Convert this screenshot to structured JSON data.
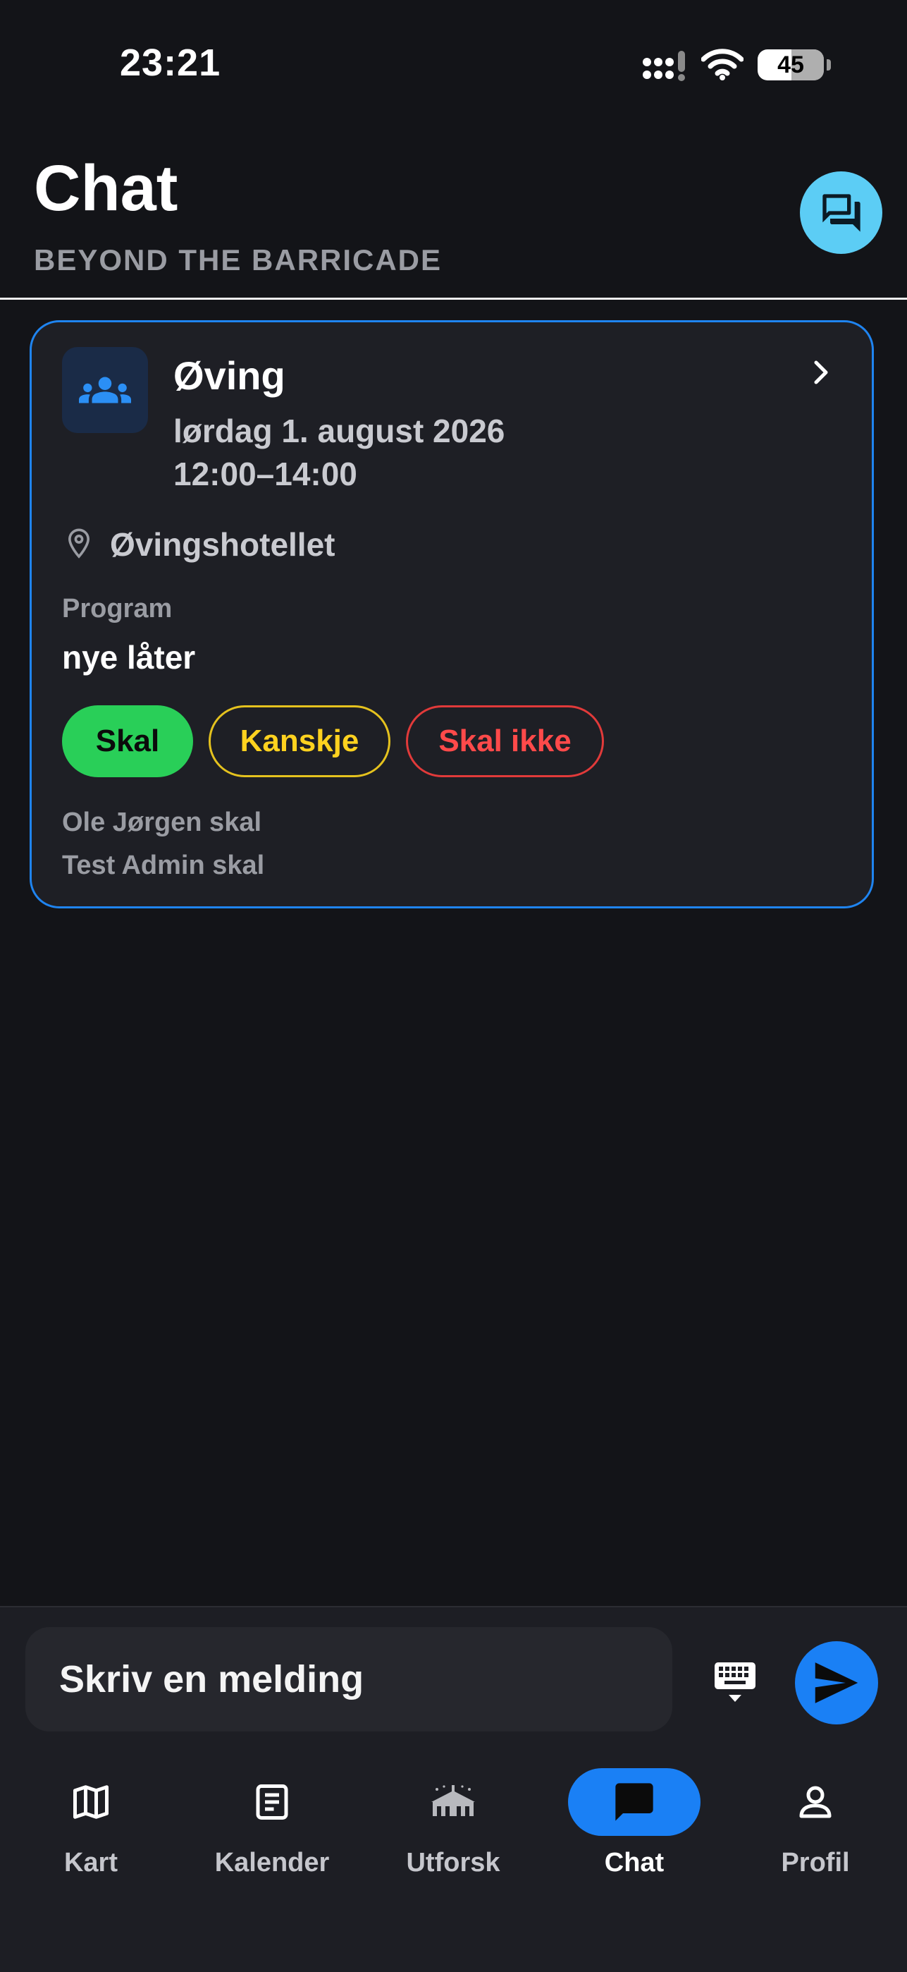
{
  "status_bar": {
    "time": "23:21",
    "battery": "45"
  },
  "header": {
    "title": "Chat",
    "subtitle": "BEYOND THE BARRICADE"
  },
  "event": {
    "title": "Øving",
    "date": "lørdag 1. august 2026",
    "time": "12:00–14:00",
    "location": "Øvingshotellet",
    "program_label": "Program",
    "program_value": "nye låter",
    "rsvp": {
      "yes": "Skal",
      "maybe": "Kanskje",
      "no": "Skal ikke"
    },
    "attendees": [
      "Ole Jørgen skal",
      "Test Admin skal"
    ]
  },
  "composer": {
    "placeholder": "Skriv en melding"
  },
  "tabs": [
    {
      "label": "Kart",
      "icon": "map-icon"
    },
    {
      "label": "Kalender",
      "icon": "document-icon"
    },
    {
      "label": "Utforsk",
      "icon": "venue-icon"
    },
    {
      "label": "Chat",
      "icon": "chat-bubble-icon",
      "active": true
    },
    {
      "label": "Profil",
      "icon": "person-icon"
    }
  ],
  "colors": {
    "background": "#131418",
    "card": "#1e1f25",
    "accent_blue": "#1a80f5",
    "new_chat_cyan": "#5ccdf5",
    "yes_green": "#29cf58",
    "maybe_yellow": "#ffd21f",
    "no_red": "#ff4a4a"
  }
}
